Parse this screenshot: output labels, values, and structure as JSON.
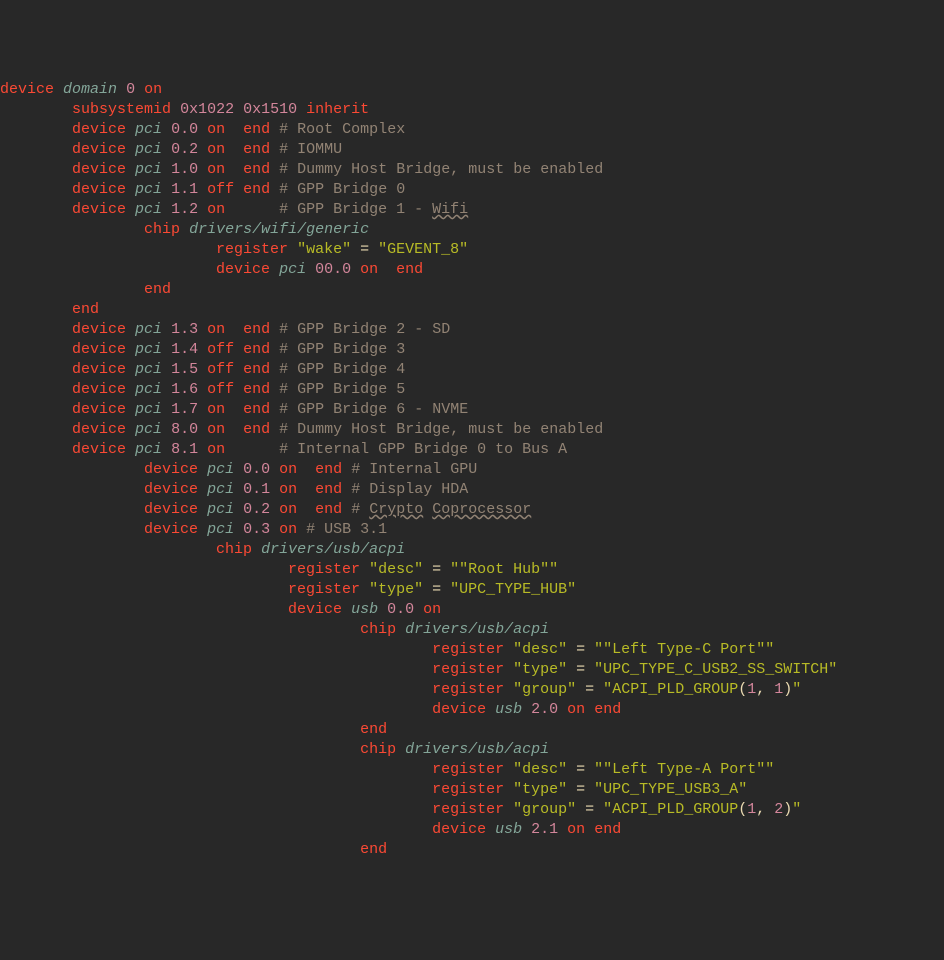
{
  "lines": [
    {
      "indent": 0,
      "type": "device-domain",
      "num": "0",
      "state": "on",
      "comment": ""
    },
    {
      "indent": 8,
      "type": "subsystemid",
      "hex1": "0x1022",
      "hex2": "0x1510"
    },
    {
      "indent": 8,
      "type": "device-pci",
      "addr": "0.0",
      "state": "on",
      "end": true,
      "pad": "  ",
      "comment": "# Root Complex"
    },
    {
      "indent": 8,
      "type": "device-pci",
      "addr": "0.2",
      "state": "on",
      "end": true,
      "pad": "  ",
      "comment": "# IOMMU"
    },
    {
      "indent": 8,
      "type": "device-pci",
      "addr": "1.0",
      "state": "on",
      "end": true,
      "pad": "  ",
      "comment": "# Dummy Host Bridge, must be enabled"
    },
    {
      "indent": 8,
      "type": "device-pci",
      "addr": "1.1",
      "state": "off",
      "end": true,
      "pad": " ",
      "comment": "# GPP Bridge 0"
    },
    {
      "indent": 8,
      "type": "device-pci",
      "addr": "1.2",
      "state": "on",
      "end": false,
      "pad": "      ",
      "comment": "# GPP Bridge 1 - ",
      "wavy": "Wifi"
    },
    {
      "indent": 16,
      "type": "chip",
      "path": "drivers/wifi/generic"
    },
    {
      "indent": 24,
      "type": "register",
      "key": "\"wake\"",
      "val": "\"GEVENT_8\""
    },
    {
      "indent": 24,
      "type": "device-pci",
      "addr": "00.0",
      "state": "on",
      "end": true,
      "pad": "  ",
      "comment": ""
    },
    {
      "indent": 16,
      "type": "end"
    },
    {
      "indent": 8,
      "type": "end"
    },
    {
      "indent": 8,
      "type": "device-pci",
      "addr": "1.3",
      "state": "on",
      "end": true,
      "pad": "  ",
      "comment": "# GPP Bridge 2 - SD"
    },
    {
      "indent": 8,
      "type": "device-pci",
      "addr": "1.4",
      "state": "off",
      "end": true,
      "pad": " ",
      "comment": "# GPP Bridge 3"
    },
    {
      "indent": 8,
      "type": "device-pci",
      "addr": "1.5",
      "state": "off",
      "end": true,
      "pad": " ",
      "comment": "# GPP Bridge 4"
    },
    {
      "indent": 8,
      "type": "device-pci",
      "addr": "1.6",
      "state": "off",
      "end": true,
      "pad": " ",
      "comment": "# GPP Bridge 5"
    },
    {
      "indent": 8,
      "type": "device-pci",
      "addr": "1.7",
      "state": "on",
      "end": true,
      "pad": "  ",
      "comment": "# GPP Bridge 6 - NVME"
    },
    {
      "indent": 8,
      "type": "device-pci",
      "addr": "8.0",
      "state": "on",
      "end": true,
      "pad": "  ",
      "comment": "# Dummy Host Bridge, must be enabled"
    },
    {
      "indent": 8,
      "type": "device-pci",
      "addr": "8.1",
      "state": "on",
      "end": false,
      "pad": "      ",
      "comment": "# Internal GPP Bridge 0 to Bus A"
    },
    {
      "indent": 16,
      "type": "device-pci",
      "addr": "0.0",
      "state": "on",
      "end": true,
      "pad": "  ",
      "comment": "# Internal GPU"
    },
    {
      "indent": 16,
      "type": "device-pci",
      "addr": "0.1",
      "state": "on",
      "end": true,
      "pad": "  ",
      "comment": "# Display HDA"
    },
    {
      "indent": 16,
      "type": "device-pci",
      "addr": "0.2",
      "state": "on",
      "end": true,
      "pad": "  ",
      "comment": "# ",
      "wavy2": [
        "Crypto",
        "Coprocessor"
      ]
    },
    {
      "indent": 16,
      "type": "device-pci",
      "addr": "0.3",
      "state": "on",
      "end": false,
      "pad": " ",
      "comment": "# USB 3.1"
    },
    {
      "indent": 24,
      "type": "chip",
      "path": "drivers/usb/acpi"
    },
    {
      "indent": 32,
      "type": "register",
      "key": "\"desc\"",
      "val": "\"\"Root Hub\"\""
    },
    {
      "indent": 32,
      "type": "register",
      "key": "\"type\"",
      "val": "\"UPC_TYPE_HUB\""
    },
    {
      "indent": 32,
      "type": "device-usb",
      "addr": "0.0",
      "state": "on",
      "end": false,
      "pad": "",
      "comment": ""
    },
    {
      "indent": 40,
      "type": "chip",
      "path": "drivers/usb/acpi"
    },
    {
      "indent": 48,
      "type": "register",
      "key": "\"desc\"",
      "val": "\"\"Left Type-C Port\"\""
    },
    {
      "indent": 48,
      "type": "register",
      "key": "\"type\"",
      "val": "\"UPC_TYPE_C_USB2_SS_SWITCH\""
    },
    {
      "indent": 48,
      "type": "register-fn",
      "key": "\"group\"",
      "fn": "ACPI_PLD_GROUP",
      "args": [
        "1",
        "1"
      ]
    },
    {
      "indent": 48,
      "type": "device-usb",
      "addr": "2.0",
      "state": "on",
      "end": true,
      "pad": " ",
      "comment": ""
    },
    {
      "indent": 40,
      "type": "end"
    },
    {
      "indent": 40,
      "type": "chip",
      "path": "drivers/usb/acpi"
    },
    {
      "indent": 48,
      "type": "register",
      "key": "\"desc\"",
      "val": "\"\"Left Type-A Port\"\""
    },
    {
      "indent": 48,
      "type": "register",
      "key": "\"type\"",
      "val": "\"UPC_TYPE_USB3_A\""
    },
    {
      "indent": 48,
      "type": "register-fn",
      "key": "\"group\"",
      "fn": "ACPI_PLD_GROUP",
      "args": [
        "1",
        "2"
      ]
    },
    {
      "indent": 48,
      "type": "device-usb",
      "addr": "2.1",
      "state": "on",
      "end": true,
      "pad": " ",
      "comment": ""
    },
    {
      "indent": 40,
      "type": "end"
    }
  ],
  "kw": {
    "device": "device",
    "domain": "domain",
    "pci": "pci",
    "usb": "usb",
    "on": "on",
    "off": "off",
    "end": "end",
    "subsystemid": "subsystemid",
    "inherit": "inherit",
    "chip": "chip",
    "register": "register"
  }
}
